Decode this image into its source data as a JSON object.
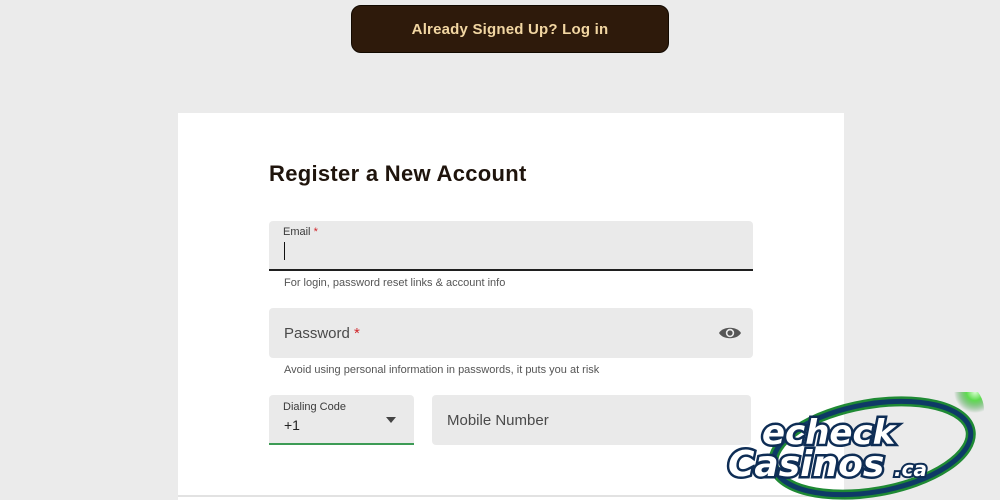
{
  "header": {
    "login_label": "Already Signed Up? Log in"
  },
  "form": {
    "title": "Register a New Account",
    "email": {
      "label": "Email",
      "required": "*",
      "value": "",
      "helper": "For login, password reset links & account info"
    },
    "password": {
      "label": "Password",
      "required": "*",
      "helper": "Avoid using personal information in passwords, it puts you at risk"
    },
    "dialing_code": {
      "label": "Dialing Code",
      "value": "+1"
    },
    "mobile": {
      "placeholder": "Mobile Number"
    }
  },
  "watermark": {
    "line1": "echeck",
    "line2": "Casinos",
    "suffix": ".ca"
  },
  "colors": {
    "brand_dark": "#2e1a0b",
    "brand_text": "#f2d6a2",
    "focus_green": "#3d9b55",
    "required_red": "#d0262b"
  },
  "icons": {
    "password_toggle": "eye-icon",
    "dial_dropdown": "caret-down-icon"
  }
}
